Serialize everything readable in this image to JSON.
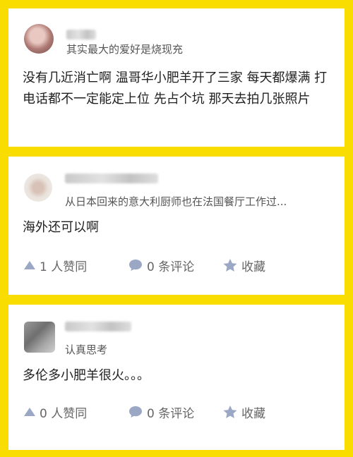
{
  "posts": [
    {
      "bio": "其实最大的爱好是烧现充",
      "content": "没有几近消亡啊 温哥华小肥羊开了三家 每天都爆满 打电话都不一定能定上位 先占个坑 那天去拍几张照片"
    },
    {
      "bio": "从日本回来的意大利厨师也在法国餐厅工作过...",
      "content": "海外还可以啊",
      "actions": {
        "like": "1 人赞同",
        "comment": "0 条评论",
        "favorite": "收藏"
      }
    },
    {
      "bio": "认真思考",
      "content": "多伦多小肥羊很火。。。",
      "actions": {
        "like": "0 人赞同",
        "comment": "0 条评论",
        "favorite": "收藏"
      }
    }
  ],
  "colors": {
    "background": "#f9dd00",
    "card": "#ffffff",
    "icon": "#9aa8c6",
    "action_text": "#666666"
  },
  "icons": {
    "like": "triangle-up-icon",
    "comment": "speech-bubble-icon",
    "favorite": "star-icon"
  }
}
